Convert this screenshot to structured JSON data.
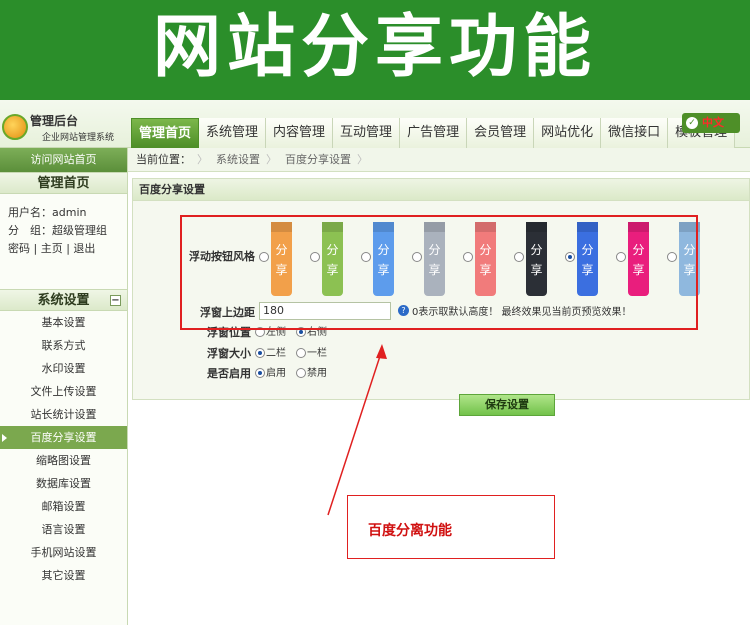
{
  "banner": {
    "title": "网站分享功能"
  },
  "header": {
    "logo_title": "管理后台",
    "logo_sub": "企业网站管理系统",
    "lang_label": "中文",
    "nav": [
      "管理首页",
      "系统管理",
      "内容管理",
      "互动管理",
      "广告管理",
      "会员管理",
      "网站优化",
      "微信接口",
      "模板管理"
    ]
  },
  "sidebar": {
    "home": "访问网站首页",
    "section_home": "管理首页",
    "user_label": "用户名：admin",
    "group_label": "分　组：超级管理组",
    "links": [
      "密码",
      "主页",
      "退出"
    ],
    "section_system": "系统设置",
    "menu": [
      "基本设置",
      "联系方式",
      "水印设置",
      "文件上传设置",
      "站长统计设置",
      "百度分享设置",
      "缩略图设置",
      "数据库设置",
      "邮箱设置",
      "语言设置",
      "手机网站设置",
      "其它设置"
    ],
    "active_index": 5
  },
  "breadcrumb": {
    "label": "当前位置：",
    "items": [
      "系统设置",
      "百度分享设置"
    ]
  },
  "panel": {
    "title": "百度分享设置",
    "style_label": "浮动按钮风格",
    "style_tag_top": "分",
    "style_tag_bottom": "享",
    "styles": [
      {
        "color": "#f2a04a",
        "selected": false
      },
      {
        "color": "#8cc152",
        "selected": false
      },
      {
        "color": "#5d9cec",
        "selected": false
      },
      {
        "color": "#aab2bd",
        "selected": false
      },
      {
        "color": "#f17b7b",
        "selected": false
      },
      {
        "color": "#2b2f36",
        "selected": false
      },
      {
        "color": "#3b6fe0",
        "selected": true
      },
      {
        "color": "#e91e7d",
        "selected": false
      },
      {
        "color": "#8fb8de",
        "selected": false
      }
    ],
    "top_margin_label": "浮窗上边距",
    "top_margin_value": "180",
    "top_margin_help": "0表示取默认高度！ 最终效果见当前页预览效果！",
    "position_label": "浮窗位置",
    "position_options": [
      "左侧",
      "右侧"
    ],
    "position_selected": 1,
    "size_label": "浮窗大小",
    "size_options": [
      "二栏",
      "一栏"
    ],
    "size_selected": 0,
    "enable_label": "是否启用",
    "enable_options": [
      "启用",
      "禁用"
    ],
    "enable_selected": 0,
    "save_label": "保存设置"
  },
  "annotation": {
    "note": "百度分离功能"
  }
}
